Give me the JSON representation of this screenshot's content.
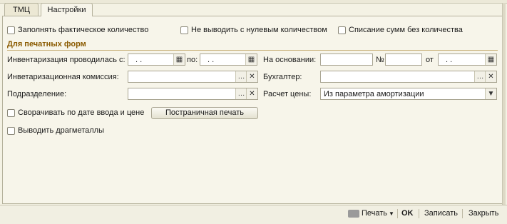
{
  "tabs": [
    {
      "label": "ТМЦ"
    },
    {
      "label": "Настройки"
    }
  ],
  "checkboxes": {
    "fill_actual": {
      "label": "Заполнять фактическое количество",
      "checked": false
    },
    "no_zero": {
      "label": "Не выводить с нулевым количеством",
      "checked": false
    },
    "write_off": {
      "label": "Списание сумм без количества",
      "checked": false
    },
    "collapse": {
      "label": "Сворачивать по дате ввода и цене",
      "checked": false
    },
    "precious": {
      "label": "Выводить драгметаллы",
      "checked": false
    }
  },
  "section_title": "Для печатных форм",
  "form": {
    "inv_date_label": "Инвентаризация проводилась с:",
    "inv_date_from": ". .",
    "to_label": "по:",
    "inv_date_to": ". .",
    "basis_label": "На основании:",
    "basis_value": "",
    "number_label": "№",
    "number_value": "",
    "from_label": "от",
    "basis_date": ". .",
    "commission_label": "Инветаризационная комиссия:",
    "commission_value": "",
    "accountant_label": "Бухгалтер:",
    "accountant_value": "",
    "department_label": "Подразделение:",
    "department_value": "",
    "price_label": "Расчет цены:",
    "price_value": "Из параметра амортизации"
  },
  "buttons": {
    "page_print": "Постраничная печать",
    "print": "Печать",
    "ok": "OK",
    "save": "Записать",
    "close": "Закрыть"
  },
  "icons": {
    "calendar": "calendar-icon",
    "select": "ellipsis-icon",
    "clear": "clear-icon",
    "dropdown": "chevron-down-icon",
    "printer": "printer-icon"
  }
}
